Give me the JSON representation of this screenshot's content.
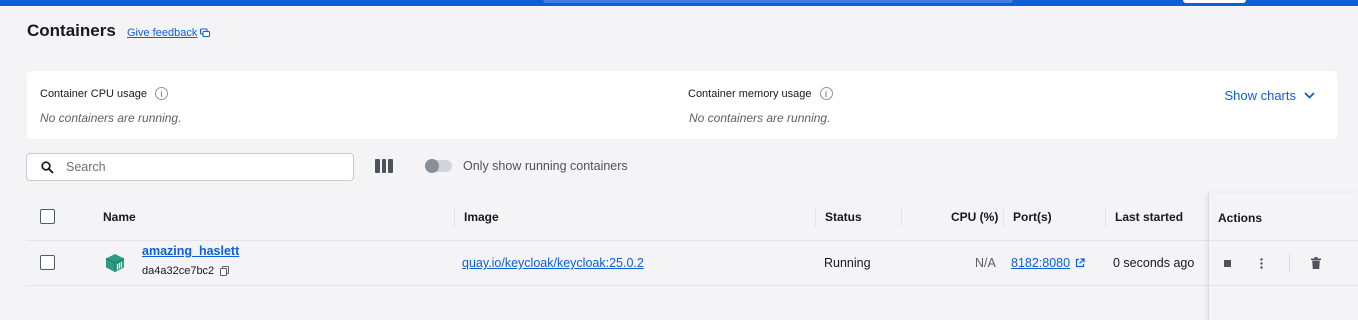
{
  "page": {
    "title": "Containers",
    "feedback_label": "Give feedback"
  },
  "stats": {
    "cpu": {
      "label": "Container CPU usage",
      "empty": "No containers are running."
    },
    "memory": {
      "label": "Container memory usage",
      "empty": "No containers are running."
    },
    "show_charts_label": "Show charts"
  },
  "toolbar": {
    "search_placeholder": "Search",
    "search_value": "",
    "toggle_label": "Only show running containers",
    "toggle_on": false
  },
  "table": {
    "columns": {
      "name": "Name",
      "image": "Image",
      "status": "Status",
      "cpu": "CPU (%)",
      "ports": "Port(s)",
      "last_started": "Last started",
      "actions": "Actions"
    },
    "rows": [
      {
        "name": "amazing_haslett",
        "id": "da4a32ce7bc2",
        "image": "quay.io/keycloak/keycloak:25.0.2",
        "status": "Running",
        "cpu": "N/A",
        "ports": "8182:8080",
        "last_started": "0 seconds ago"
      }
    ]
  },
  "icons": {
    "feedback": "chat-bubble-icon",
    "info": "info-circle-icon",
    "chevron": "chevron-down-icon",
    "search": "search-icon",
    "columns": "columns-icon",
    "container": "container-cube-icon",
    "copy": "copy-icon",
    "external_link": "external-link-icon",
    "stop": "stop-icon",
    "more": "more-vertical-icon",
    "delete": "trash-icon"
  },
  "colors": {
    "accent": "#0d5fd6",
    "container_icon": "#2d9c83",
    "background": "#f4f4f6"
  }
}
